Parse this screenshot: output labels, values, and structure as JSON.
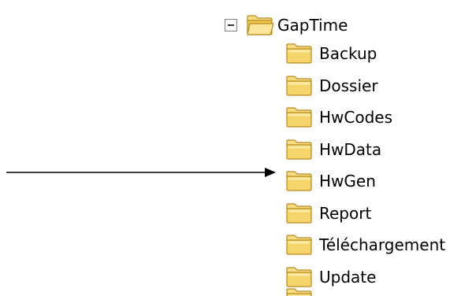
{
  "tree": {
    "root": {
      "label": "GapTime",
      "expanded": true,
      "expander_symbol": "minus",
      "icon": "open-folder-icon"
    },
    "children": [
      {
        "label": "Backup",
        "icon": "folder-icon"
      },
      {
        "label": "Dossier",
        "icon": "folder-icon"
      },
      {
        "label": "HwCodes",
        "icon": "folder-icon"
      },
      {
        "label": "HwData",
        "icon": "folder-icon"
      },
      {
        "label": "HwGen",
        "icon": "folder-icon"
      },
      {
        "label": "Report",
        "icon": "folder-icon"
      },
      {
        "label": "Téléchargement",
        "icon": "folder-icon"
      },
      {
        "label": "Update",
        "icon": "folder-icon"
      }
    ]
  },
  "annotation": {
    "icon": "right-arrow-icon",
    "points_to": "HwGen"
  },
  "colors": {
    "folder_fill": "#f5d56b",
    "folder_light": "#fbe9a6",
    "folder_stroke": "#b78b1c",
    "text": "#000000",
    "arrow": "#000000"
  }
}
